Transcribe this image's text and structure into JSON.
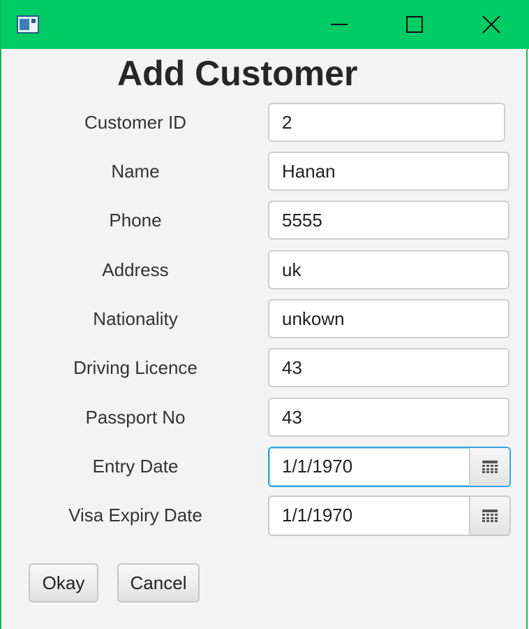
{
  "window": {
    "title_text": "",
    "controls": {
      "minimize": "minimize-icon",
      "maximize": "maximize-icon",
      "close": "close-icon"
    },
    "accent_color": "#00cc66"
  },
  "form": {
    "title": "Add Customer",
    "fields": [
      {
        "label": "Customer ID",
        "value": "2"
      },
      {
        "label": "Name",
        "value": "Hanan"
      },
      {
        "label": "Phone",
        "value": "5555"
      },
      {
        "label": "Address",
        "value": "uk"
      },
      {
        "label": "Nationality",
        "value": "unkown"
      },
      {
        "label": "Driving Licence",
        "value": "43"
      },
      {
        "label": "Passport No",
        "value": "43"
      },
      {
        "label": "Entry Date",
        "value": "1/1/1970"
      },
      {
        "label": "Visa Expiry Date",
        "value": "1/1/1970"
      }
    ],
    "focused_field": "Entry Date"
  },
  "buttons": {
    "okay": "Okay",
    "cancel": "Cancel"
  }
}
